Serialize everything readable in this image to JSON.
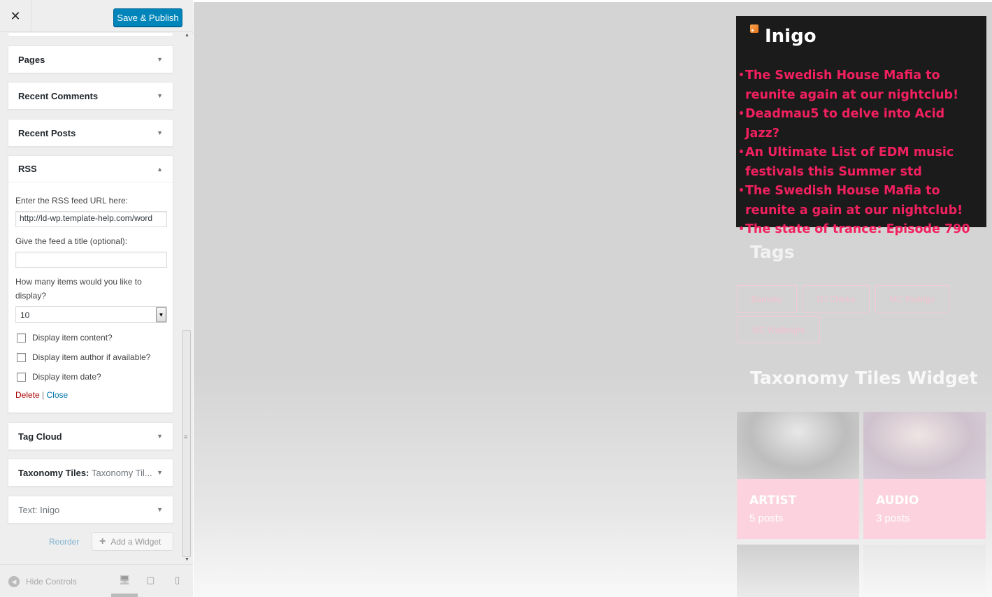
{
  "header": {
    "close_icon": "close-icon",
    "publish_label": "Save & Publish"
  },
  "widgets": {
    "pages": {
      "title": "Pages"
    },
    "recent_comments": {
      "title": "Recent Comments"
    },
    "recent_posts": {
      "title": "Recent Posts"
    },
    "rss": {
      "title": "RSS",
      "url_label": "Enter the RSS feed URL here:",
      "url_value": "http://ld-wp.template-help.com/word",
      "title_label": "Give the feed a title (optional):",
      "title_value": "",
      "count_label": "How many items would you like to display?",
      "count_value": "10",
      "checkboxes": [
        {
          "label": "Display item content?",
          "checked": false
        },
        {
          "label": "Display item author if available?",
          "checked": false
        },
        {
          "label": "Display item date?",
          "checked": false
        }
      ],
      "delete_label": "Delete",
      "separator": "|",
      "close_label": "Close"
    },
    "tag_cloud": {
      "title": "Tag Cloud"
    },
    "taxonomy": {
      "title": "Taxonomy Tiles:",
      "subtitle": "Taxonomy Til..."
    },
    "text": {
      "title": "Text:",
      "subtitle": "Inigo"
    }
  },
  "actions": {
    "reorder_label": "Reorder",
    "add_widget_label": "Add a Widget"
  },
  "footer": {
    "hide_controls_label": "Hide Controls"
  },
  "preview": {
    "rss": {
      "title": "Inigo",
      "items": [
        "The Swedish House Mafia to reunite again at our nightclub!",
        "Deadmau5 to delve into Acid Jazz?",
        "An Ultimate List of EDM music festivals this Summer std",
        "The Swedish House Mafia to reunite a gain at our nightclub!",
        "The state of trance: Episode 790"
      ]
    },
    "tags": {
      "heading": "Tags",
      "items": [
        "Barnaby",
        "DJ Chicka",
        "MC Rodrigo",
        "MC Wallbright"
      ]
    },
    "tiles": {
      "heading": "Taxonomy Tiles Widget",
      "items": [
        {
          "name": "ARTIST",
          "count": "5 posts"
        },
        {
          "name": "AUDIO",
          "count": "3 posts"
        }
      ]
    }
  },
  "colors": {
    "accent": "#0085ba",
    "rss_link": "#f2205f",
    "rss_bg": "#1b1b1b"
  }
}
